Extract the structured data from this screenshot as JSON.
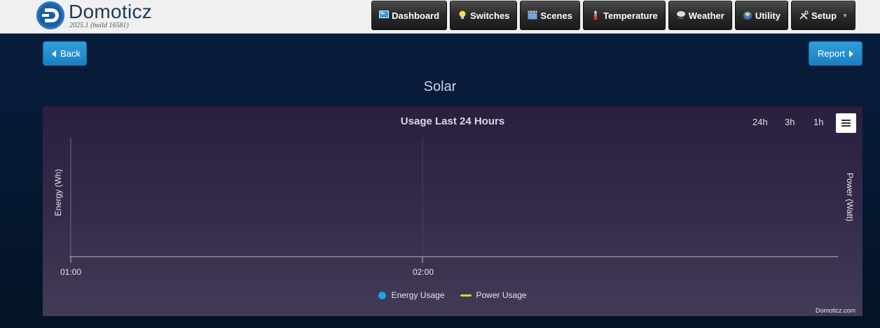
{
  "header": {
    "brand": "Domoticz",
    "version": "2025.1 (build 16581)",
    "nav": [
      {
        "label": "Dashboard",
        "icon": "dashboard-icon"
      },
      {
        "label": "Switches",
        "icon": "lightbulb-icon"
      },
      {
        "label": "Scenes",
        "icon": "clapper-icon"
      },
      {
        "label": "Temperature",
        "icon": "thermometer-icon"
      },
      {
        "label": "Weather",
        "icon": "cloud-rain-icon"
      },
      {
        "label": "Utility",
        "icon": "utility-icon"
      },
      {
        "label": "Setup",
        "icon": "tools-icon"
      }
    ]
  },
  "toolbar": {
    "back_label": "Back",
    "report_label": "Report"
  },
  "page": {
    "title": "Solar"
  },
  "chart_data": {
    "type": "line",
    "title": "Usage Last 24 Hours",
    "x_tick_labels": [
      "01:00",
      "02:00"
    ],
    "ylabel_left": "Energy (Wh)",
    "ylabel_right": "Power (Watt)",
    "series": [
      {
        "name": "Energy Usage",
        "color": "#1ea1e0",
        "values": []
      },
      {
        "name": "Power Usage",
        "color": "#e2d41c",
        "values": []
      }
    ],
    "range_buttons": [
      "24h",
      "3h",
      "1h"
    ],
    "credits": "Domoticz.com",
    "legend_position": "bottom-center",
    "grid": true
  }
}
